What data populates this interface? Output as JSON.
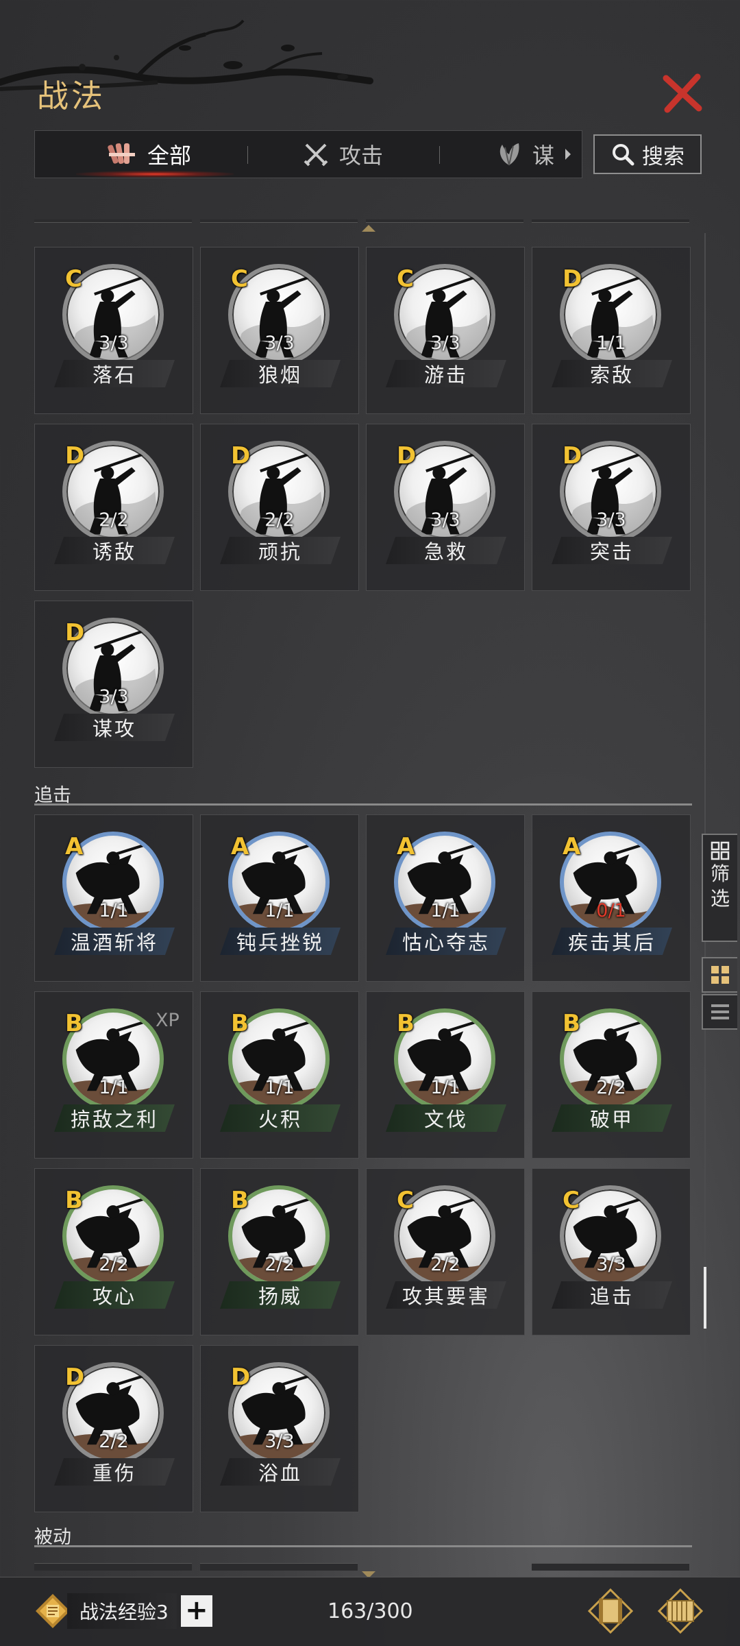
{
  "header": {
    "title": "战法",
    "search_label": "搜索"
  },
  "tabs": [
    {
      "label": "全部",
      "icon": "bundle-icon",
      "active": true
    },
    {
      "label": "攻击",
      "icon": "crossed-swords-icon",
      "active": false
    },
    {
      "label": "谋",
      "icon": "feather-fan-icon",
      "active": false
    }
  ],
  "sections": [
    {
      "label": "追击"
    },
    {
      "label": "被动"
    }
  ],
  "cards_top": [
    {
      "grade": "C",
      "count": "3/3",
      "name": "落石"
    },
    {
      "grade": "C",
      "count": "3/3",
      "name": "狼烟"
    },
    {
      "grade": "C",
      "count": "3/3",
      "name": "游击"
    },
    {
      "grade": "D",
      "count": "1/1",
      "name": "索敌"
    },
    {
      "grade": "D",
      "count": "2/2",
      "name": "诱敌"
    },
    {
      "grade": "D",
      "count": "2/2",
      "name": "顽抗"
    },
    {
      "grade": "D",
      "count": "3/3",
      "name": "急救"
    },
    {
      "grade": "D",
      "count": "3/3",
      "name": "突击"
    },
    {
      "grade": "D",
      "count": "3/3",
      "name": "谋攻"
    }
  ],
  "cards_pursuit": [
    {
      "grade": "A",
      "count": "1/1",
      "name": "温酒斩将"
    },
    {
      "grade": "A",
      "count": "1/1",
      "name": "钝兵挫锐"
    },
    {
      "grade": "A",
      "count": "1/1",
      "name": "怙心夺志"
    },
    {
      "grade": "A",
      "count": "0/1",
      "name": "疾击其后"
    },
    {
      "grade": "B",
      "count": "1/1",
      "name": "掠敌之利",
      "badge": "XP"
    },
    {
      "grade": "B",
      "count": "1/1",
      "name": "火积"
    },
    {
      "grade": "B",
      "count": "1/1",
      "name": "文伐"
    },
    {
      "grade": "B",
      "count": "2/2",
      "name": "破甲"
    },
    {
      "grade": "B",
      "count": "2/2",
      "name": "攻心"
    },
    {
      "grade": "B",
      "count": "2/2",
      "name": "扬威"
    },
    {
      "grade": "C",
      "count": "2/2",
      "name": "攻其要害"
    },
    {
      "grade": "C",
      "count": "3/3",
      "name": "追击"
    },
    {
      "grade": "D",
      "count": "2/2",
      "name": "重伤"
    },
    {
      "grade": "D",
      "count": "3/3",
      "name": "浴血"
    }
  ],
  "side": {
    "filter_label_1": "筛",
    "filter_label_2": "选"
  },
  "footer": {
    "exp_label": "战法经验3",
    "plus_label": "+",
    "capacity": "163/300"
  },
  "colors": {
    "grade": "#f2c232",
    "title": "#e6c27a",
    "close": "#c8342c",
    "warning": "#e23a2a"
  }
}
